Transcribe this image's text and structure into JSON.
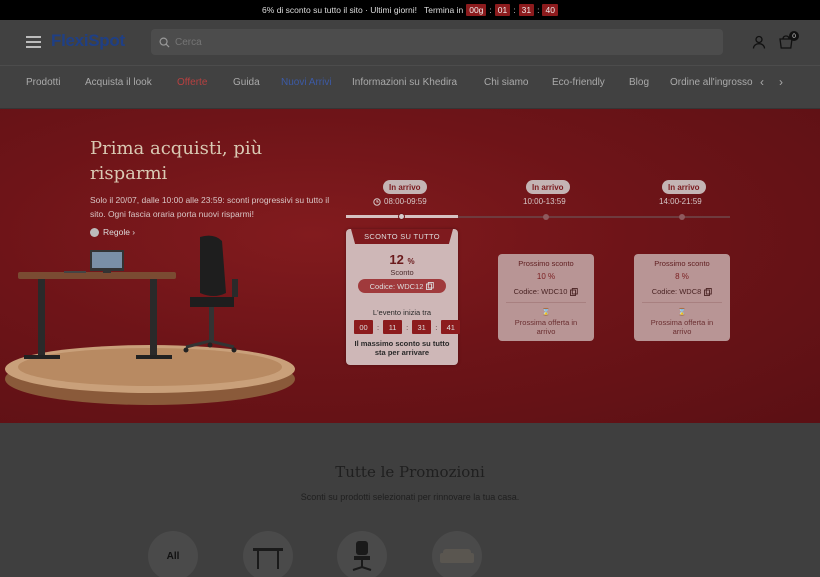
{
  "announcement": {
    "text": "6% di sconto su tutto il sito · Ultimi giorni!",
    "ends_label": "Termina in",
    "countdown": [
      "00g",
      "01",
      "31",
      "40"
    ]
  },
  "header": {
    "logo": "FlexiSpot",
    "search_placeholder": "Cerca",
    "cart_count": "0"
  },
  "nav": {
    "items": [
      {
        "label": "Prodotti",
        "style": "normal"
      },
      {
        "label": "Acquista il look",
        "style": "normal"
      },
      {
        "label": "Offerte",
        "style": "red"
      },
      {
        "label": "Guida",
        "style": "normal"
      },
      {
        "label": "Nuovi Arrivi",
        "style": "blue"
      },
      {
        "label": "Informazioni su Khedira",
        "style": "normal"
      },
      {
        "label": "Chi siamo",
        "style": "normal"
      },
      {
        "label": "Eco-friendly",
        "style": "normal"
      },
      {
        "label": "Blog",
        "style": "normal"
      },
      {
        "label": "Ordine all'ingrosso",
        "style": "normal"
      }
    ],
    "prev": "‹",
    "next": "›"
  },
  "hero": {
    "title": "Prima acquisti, più risparmi",
    "description": "Solo il 20/07, dalle 10:00 alle 23:59: sconti progressivi su tutto il sito. Ogni fascia oraria porta nuovi risparmi!",
    "rules_label": "Regole ›",
    "slots": [
      {
        "status": "In arrivo",
        "time": "08:00-09:59"
      },
      {
        "status": "In arrivo",
        "time": "10:00-13:59"
      },
      {
        "status": "In arrivo",
        "time": "14:00-21:59"
      }
    ],
    "active_card": {
      "ribbon": "SCONTO SU TUTTO",
      "percent": "12",
      "percent_sign": "%",
      "label": "Sconto",
      "code": "Codice: WDC12",
      "starts_label": "L'evento inizia tra",
      "countdown": [
        "00",
        "11",
        "31",
        "41"
      ],
      "note": "Il massimo sconto su tutto sta per arrivare"
    },
    "next_cards": [
      {
        "title": "Prossimo sconto",
        "percent": "10 %",
        "code": "Codice: WDC10",
        "note": "Prossima offerta in arrivo"
      },
      {
        "title": "Prossimo sconto",
        "percent": "8 %",
        "code": "Codice: WDC8",
        "note": "Prossima offerta in arrivo"
      }
    ]
  },
  "promotions": {
    "title": "Tutte le Promozioni",
    "subtitle": "Sconti su prodotti selezionati per rinnovare la tua casa.",
    "categories": [
      {
        "label": "All",
        "icon": "all-label"
      },
      {
        "label": "",
        "icon": "desk-icon"
      },
      {
        "label": "",
        "icon": "office-chair-icon"
      },
      {
        "label": "",
        "icon": "sofa-icon"
      }
    ]
  }
}
